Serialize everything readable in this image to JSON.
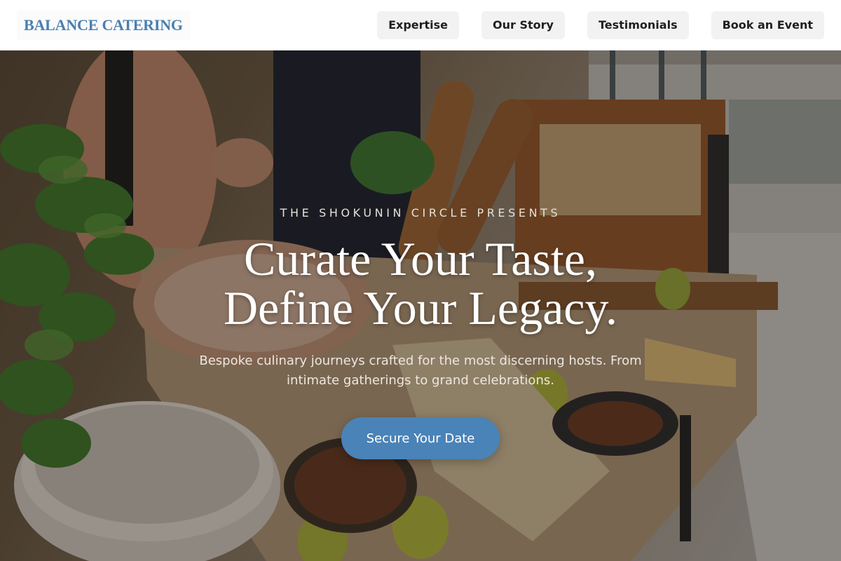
{
  "brand": {
    "name": "BALANCE CATERING",
    "accent_color": "#4a7fb0"
  },
  "nav": {
    "items": [
      {
        "label": "Expertise"
      },
      {
        "label": "Our Story"
      },
      {
        "label": "Testimonials"
      },
      {
        "label": "Book an Event"
      }
    ]
  },
  "hero": {
    "eyebrow": "THE SHOKUNIN CIRCLE PRESENTS",
    "headline_line1": "Curate Your Taste,",
    "headline_line2": "Define Your Legacy.",
    "subtext": "Bespoke culinary journeys crafted for the most discerning hosts. From intimate gatherings to grand celebrations.",
    "cta_label": "Secure Your Date",
    "cta_color": "#4a83b8",
    "background_image": "catering-buffet-photo"
  }
}
